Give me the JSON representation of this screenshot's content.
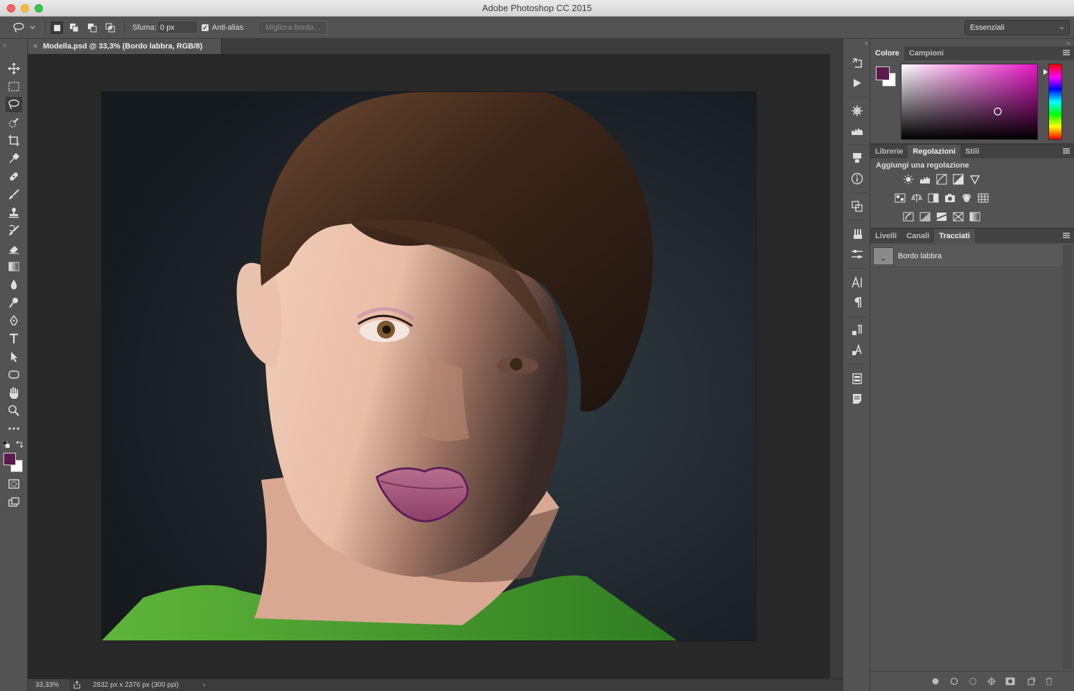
{
  "window": {
    "title": "Adobe Photoshop CC 2015"
  },
  "options_bar": {
    "tool_icon": "lasso-icon",
    "selection_modes": [
      "new-selection",
      "add-to-selection",
      "subtract-from-selection",
      "intersect-selection"
    ],
    "feather_label": "Sfuma:",
    "feather_value": "0 px",
    "antialias_label": "Anti-alias",
    "antialias_checked": true,
    "refine_edge_label": "Migliora bordo...",
    "workspace": "Essenziali"
  },
  "document": {
    "tab_title": "Modella.psd @ 33,3% (Bordo labbra, RGB/8)",
    "close_glyph": "×"
  },
  "status": {
    "zoom": "33,33%",
    "doc_info": "2832 px x 2376 px (300 ppi)",
    "more_glyph": "›"
  },
  "toolbar": {
    "tools": [
      "move",
      "rectangular-marquee",
      "lasso",
      "quick-selection",
      "crop",
      "eyedropper",
      "healing-brush",
      "brush",
      "clone-stamp",
      "history-brush",
      "eraser",
      "gradient",
      "blur",
      "dodge",
      "pen",
      "type",
      "path-selection",
      "ellipse",
      "hand",
      "zoom",
      "more-tools"
    ],
    "active_tool": "lasso",
    "foreground_color": "#5a1a4e",
    "background_color": "#ffffff"
  },
  "color_panel": {
    "tabs": [
      "Colore",
      "Campioni"
    ],
    "active_tab": "Colore",
    "hue_color": "#e818c8"
  },
  "adjustments_panel": {
    "tabs": [
      "Librerie",
      "Regolazioni",
      "Stili"
    ],
    "active_tab": "Regolazioni",
    "title": "Aggiungi una regolazione"
  },
  "paths_panel": {
    "tabs": [
      "Livelli",
      "Canali",
      "Tracciati"
    ],
    "active_tab": "Tracciati",
    "paths": [
      {
        "name": "Bordo labbra"
      }
    ]
  },
  "colors": {
    "panel_bg": "#535353",
    "canvas_bg": "#282828",
    "lip_stroke": "#5e1d5a"
  }
}
